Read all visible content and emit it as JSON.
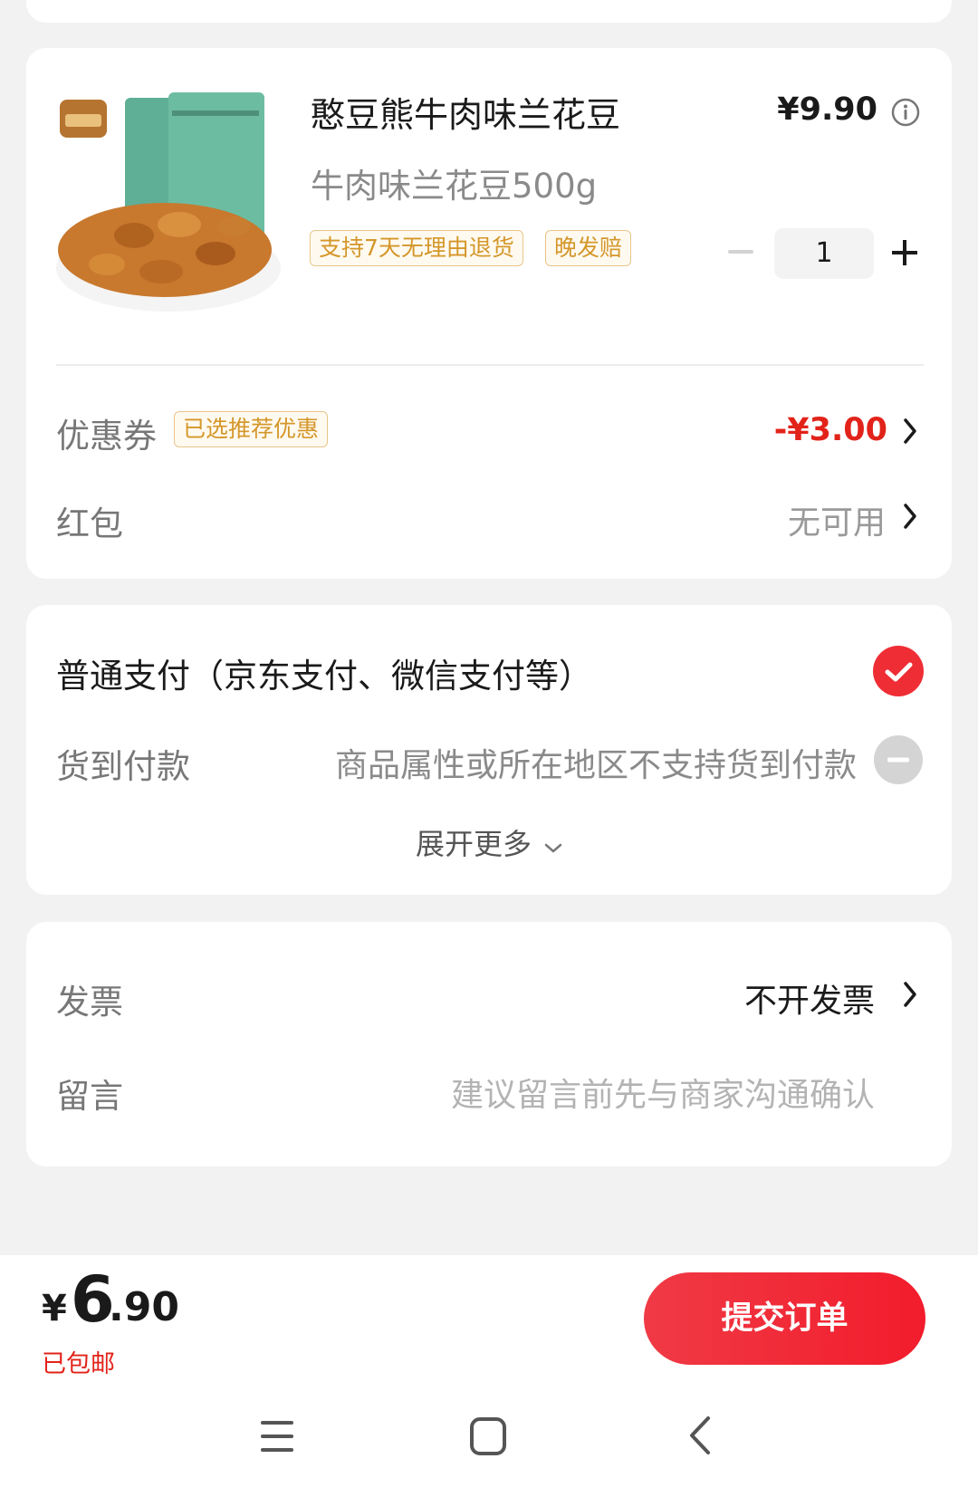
{
  "product": {
    "name": "憨豆熊牛肉味兰花豆",
    "spec": "牛肉味兰花豆500g",
    "price": "¥9.90",
    "tags": [
      "支持7天无理由退货",
      "晚发赔"
    ],
    "quantity": "1",
    "image_icon": "product-photo-icon"
  },
  "coupon": {
    "label": "优惠券",
    "tag": "已选推荐优惠",
    "value": "-¥3.00"
  },
  "red_packet": {
    "label": "红包",
    "value": "无可用"
  },
  "payment": {
    "normal_label": "普通支付（京东支付、微信支付等）",
    "cod_label": "货到付款",
    "cod_note": "商品属性或所在地区不支持货到付款",
    "expand_label": "展开更多"
  },
  "invoice": {
    "label": "发票",
    "value": "不开发票"
  },
  "message": {
    "label": "留言",
    "placeholder": "建议留言前先与商家沟通确认"
  },
  "footer": {
    "total_yen": "¥",
    "total_int": "6",
    "total_dec": ".90",
    "shipping": "已包邮",
    "submit": "提交订单"
  },
  "colors": {
    "accent_red": "#e2231a",
    "tag_gold": "#d4972a"
  },
  "icons": [
    "info-icon",
    "minus-icon",
    "plus-icon",
    "chevron-right-icon",
    "check-circle-icon",
    "disabled-circle-icon",
    "chevron-down-icon",
    "menu-icon",
    "home-icon",
    "back-icon"
  ]
}
